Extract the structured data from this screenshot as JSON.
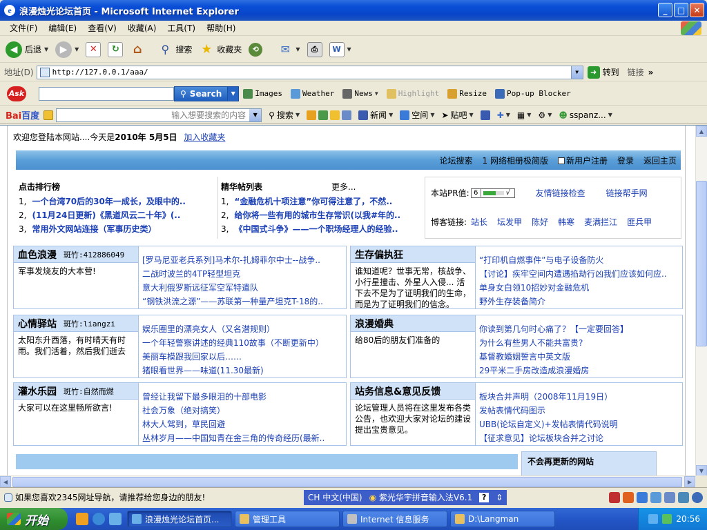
{
  "window": {
    "title": "浪漫烛光论坛首页 - Microsoft Internet Explorer"
  },
  "menu": [
    "文件(F)",
    "编辑(E)",
    "查看(V)",
    "收藏(A)",
    "工具(T)",
    "帮助(H)"
  ],
  "toolbar": {
    "back": "后退",
    "search": "搜索",
    "favorites": "收藏夹"
  },
  "address": {
    "label": "地址(D)",
    "url": "http://127.0.0.1/aaa/",
    "go": "转到",
    "links": "链接"
  },
  "ask": {
    "search_btn": "Search",
    "items": [
      "Images",
      "Weather",
      "News",
      "Highlight",
      "Resize",
      "Pop-up Blocker"
    ]
  },
  "baidu": {
    "logo_a": "Bai",
    "logo_b": "百度",
    "placeholder": "输入想要搜索的内容",
    "search": "搜索",
    "space": "空间",
    "post": "贴吧",
    "user": "sspanz..."
  },
  "page": {
    "welcome_prefix": "欢迎您登陆本网站....今天是",
    "date": "2010年 5月5日",
    "add_fav": "加入收藏夹",
    "nav": [
      "论坛搜索",
      "1 网络相册极简版",
      "新用户注册",
      "登录",
      "返回主页"
    ],
    "hot": {
      "title": "点击排行榜",
      "rows": [
        {
          "n": "1,",
          "t": "一个台湾70后的30年一成长，及眼中的.."
        },
        {
          "n": "2,",
          "t": "(11月24日更新)《黑道风云二十年》(.."
        },
        {
          "n": "3,",
          "t": "常用外文网站连接（军事历史类）"
        }
      ]
    },
    "elite": {
      "title": "精华帖列表",
      "more": "更多...",
      "rows": [
        {
          "n": "1,",
          "t": "“金融危机十项注意”你可得注意了，不然.."
        },
        {
          "n": "2,",
          "t": "给你将一些有用的城市生存常识(以我#年的.."
        },
        {
          "n": "3,",
          "t": "《中国式斗争》——一个职场经理人的经验.."
        }
      ]
    },
    "pr": {
      "label": "本站PR值:",
      "value": "6",
      "links_check": "友情链接检查",
      "links_help": "链接帮手网"
    },
    "blog": {
      "label": "博客链接:",
      "names": [
        "站长",
        "坛发甲",
        "陈好",
        "韩寒",
        "麦满拦江",
        "匪兵甲"
      ]
    },
    "forums": [
      {
        "name": "血色浪漫",
        "mod": "斑竹:412886049",
        "desc": "军事发烧友的大本营!",
        "posts": [
          "[罗马尼亚老兵系列]马术尔-扎姆菲尔中士--战争..",
          "二战时波兰的4TP轻型坦克",
          "意大利俄罗斯远征军空军特遣队",
          "“钢铁洪流之源”——苏联第一种量产坦克T-18的.."
        ]
      },
      {
        "name": "生存偏执狂",
        "mod": "",
        "desc": "谁知道呢？世事无常，核战争、小行星撞击、外星人入侵... 活下去不是为了证明我们的生命，而是为了证明我们的信念。",
        "posts": [
          "“打印机自燃事件”与电子设备防火",
          "【讨论】疾牢空间内遭遇掐劫行凶我们应该如何应..",
          "单身女白领10招妙对金融危机",
          "野外生存装备简介"
        ]
      },
      {
        "name": "心情驿站",
        "mod": "斑竹:liangzi",
        "desc": "太阳东升西落，有时晴天有时雨。我们活着，然后我们逝去",
        "posts": [
          "娱乐圈里的漂亮女人（又名潜规则）",
          "一个年轻警察讲述的经典110故事（不断更新中）",
          "美丽车模跟我回家以后……",
          "猪眼看世界——味道(11.30最新)"
        ]
      },
      {
        "name": "浪漫婚典",
        "mod": "",
        "desc": "给80后的朋友们准备的",
        "posts": [
          "你读到第几句时心痛了？【一定要回答】",
          "为什么有些男人不能共富贵?",
          "基督教婚姻誓言中英文版",
          "29平米二手房改造成浪漫婚房"
        ]
      },
      {
        "name": "灌水乐园",
        "mod": "斑竹:自然而燃",
        "desc": "大家可以在这里畅所欲言!",
        "posts": [
          "曾经让我留下最多眼泪的十部电影",
          "社会万象（绝对搞笑）",
          "林大人驾到，草民回避",
          "丛林岁月——中国知青在金三角的传奇经历(最新.."
        ]
      },
      {
        "name": "站务信息&意见反馈",
        "mod": "",
        "desc": "论坛管理人员将在这里发布各类公告，也欢迎大家对论坛的建设提出宝贵意见。",
        "posts": [
          "板块合并声明（2008年11月19日）",
          "发帖表情代码图示",
          "UBB(论坛自定义)+发帖表情代码说明",
          "【征求意见】论坛板块合并之讨论"
        ]
      }
    ],
    "nomore": "不会再更新的网站"
  },
  "status": {
    "text": "如果您喜欢2345网址导航，请推荐给您身边的朋友!",
    "ime_lang": "CH 中文(中国)",
    "ime_name": "紫光华宇拼音输入法V6.1"
  },
  "taskbar": {
    "start": "开始",
    "tasks": [
      "浪漫烛光论坛首页...",
      "管理工具",
      "Internet 信息服务",
      "D:\\Langman"
    ],
    "time": "20:56"
  }
}
